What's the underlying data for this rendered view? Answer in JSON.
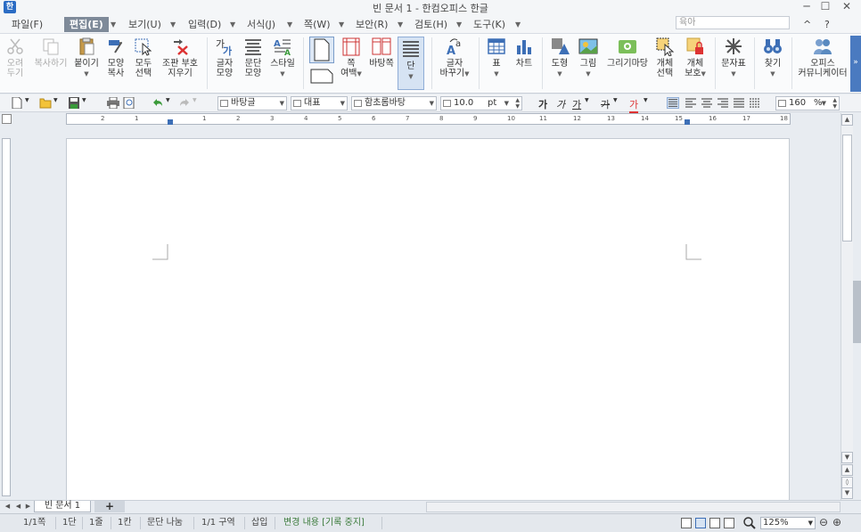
{
  "window": {
    "title": "빈 문서 1 - 한컴오피스 한글",
    "logo": "한",
    "minimize": "─",
    "maximize": "☐",
    "close": "✕"
  },
  "menu": {
    "items": [
      "파일(F)",
      "편집(E)",
      "보기(U)",
      "입력(D)",
      "서식(J)",
      "쪽(W)",
      "보안(R)",
      "검토(H)",
      "도구(K)"
    ],
    "active": "편집(E)",
    "help_placeholder": "육아",
    "ribbon_collapse": "^",
    "help": "?"
  },
  "ribbon": {
    "cut": "오려\n두기",
    "copy": "복사하기",
    "paste": "붙이기",
    "format_copy": "모양\n복사",
    "select_all": "모두\n선택",
    "clear_marks": "조판 부호\n지우기",
    "char_shape": "글자\n모양",
    "para_shape": "문단\n모양",
    "style": "스타일",
    "page_margin": "쪽\n여백",
    "background": "바탕쪽",
    "columns": "단",
    "replace_char": "글자\n바꾸기",
    "table": "표",
    "chart": "차트",
    "shape": "도형",
    "picture": "그림",
    "drawing_mart": "그리기마당",
    "object_select": "개체\n선택",
    "object_protect": "개체\n보호",
    "symbols": "문자표",
    "find": "찾기",
    "office_community": "오피스\n커뮤니케이터",
    "more": "»"
  },
  "toolbar2": {
    "style_combo": "바탕글",
    "lang_combo": "대표",
    "font_combo": "함초롬바탕",
    "font_size": "10.0",
    "font_unit": "pt",
    "bold": "가",
    "italic": "가",
    "underline": "가",
    "strike": "가",
    "color": "가",
    "zoom_value": "160",
    "zoom_unit": "%"
  },
  "ruler": {
    "numbers": [
      "2",
      "1",
      "1",
      "2",
      "3",
      "4",
      "5",
      "6",
      "7",
      "8",
      "9",
      "10",
      "11",
      "12",
      "13",
      "14",
      "15",
      "16",
      "17",
      "18"
    ]
  },
  "tabs": {
    "doc_tab": "빈 문서 1",
    "add_tab": "+"
  },
  "status": {
    "page": "1/1쪽",
    "column": "1단",
    "line": "1줄",
    "col_pos": "1칸",
    "paragraph": "문단 나눔",
    "section": "1/1 구역",
    "mode": "삽입",
    "track_changes": "변경 내용 [기록 중지]",
    "zoom": "125%",
    "zoom_out": "⊖",
    "zoom_in": "⊕",
    "track_color": "#3a7a3a"
  }
}
